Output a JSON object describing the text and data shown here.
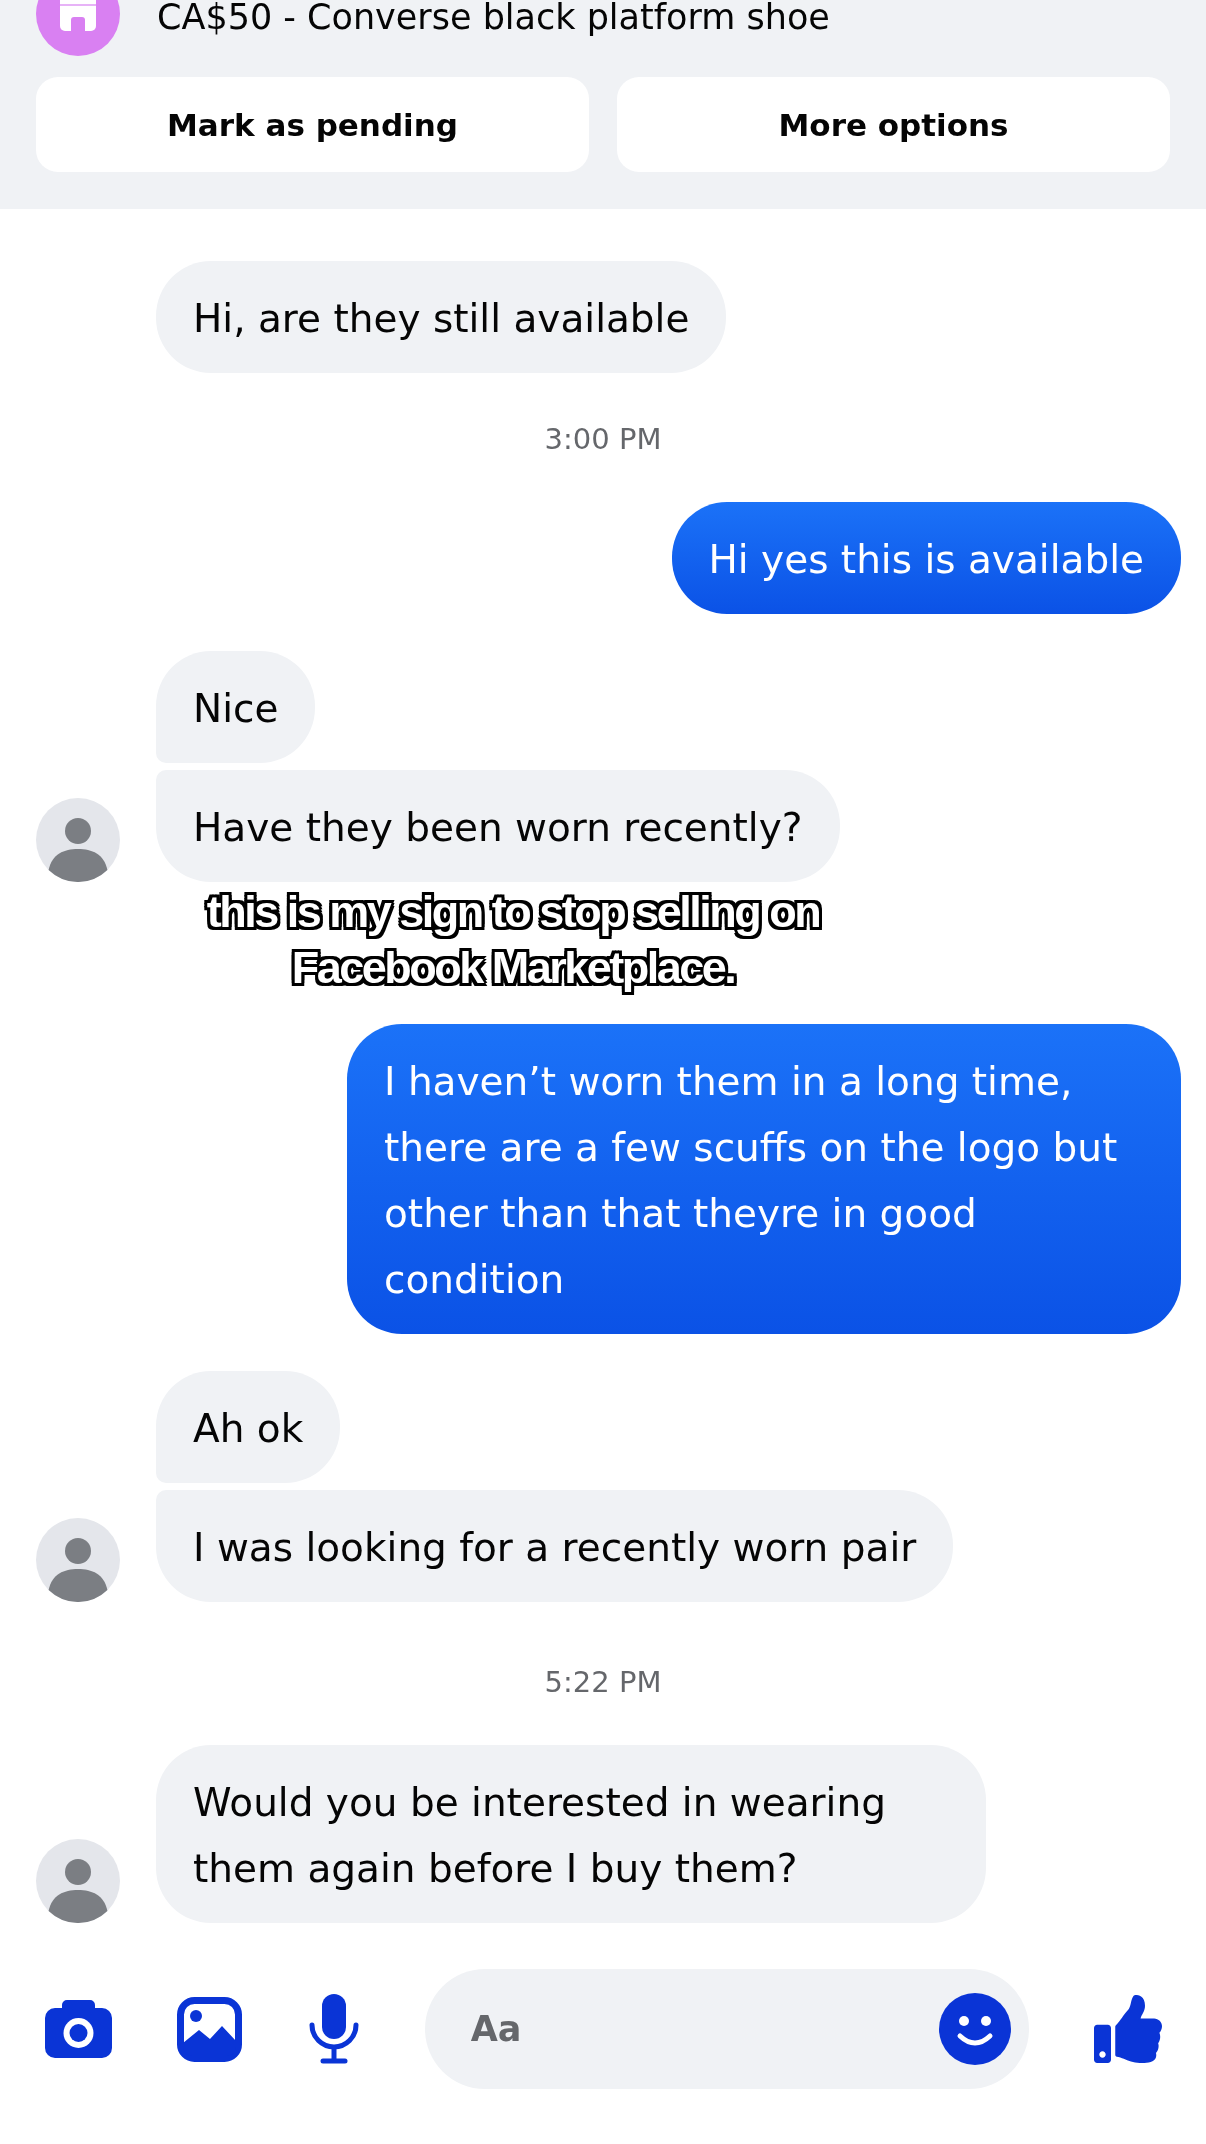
{
  "listing": {
    "title": "CA$50 - Converse black platform shoe"
  },
  "actions": [
    {
      "label": "Mark as pending"
    },
    {
      "label": "More options"
    }
  ],
  "conversation": [
    {
      "kind": "incoming",
      "text": "Hi, are they still available",
      "avatar": false
    },
    {
      "kind": "timestamp",
      "text": "3:00 PM"
    },
    {
      "kind": "outgoing",
      "text": "Hi yes this is available"
    },
    {
      "kind": "incoming",
      "text": "Nice",
      "avatar": false
    },
    {
      "kind": "incoming",
      "text": "Have they been worn recently?",
      "avatar": true
    },
    {
      "kind": "caption",
      "text": "this is my sign to stop selling on Facebook Marketplace."
    },
    {
      "kind": "outgoing",
      "text": "I haven’t worn them in a long time, there are a few scuffs on the logo but other than that theyre in good condition"
    },
    {
      "kind": "incoming",
      "text": "Ah ok",
      "avatar": false
    },
    {
      "kind": "incoming",
      "text": "I was looking for a recently worn pair",
      "avatar": true
    },
    {
      "kind": "timestamp",
      "text": "5:22 PM"
    },
    {
      "kind": "incoming",
      "text": "Would you be interested in wearing them again before I buy them?",
      "avatar": true
    }
  ],
  "composer": {
    "placeholder": "Aa"
  }
}
